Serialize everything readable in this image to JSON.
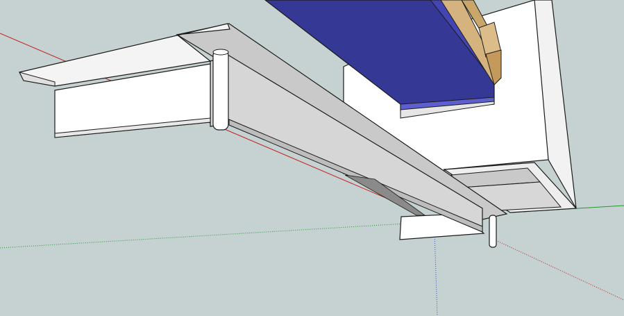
{
  "viewport": {
    "background": "#c6d1d1",
    "axes": {
      "red": "#c41e1e",
      "green": "#1f9a2a",
      "blue": "#3050c8"
    }
  },
  "model": {
    "components": [
      {
        "name": "cabinet-box",
        "color": "#ffffff"
      },
      {
        "name": "blue-panel",
        "color": "#363896"
      },
      {
        "name": "wood-rails",
        "color": "#d4b37e"
      },
      {
        "name": "table-top",
        "color": "#ffffff"
      },
      {
        "name": "long-rail",
        "color": "#d6d6d6"
      },
      {
        "name": "dowel-left",
        "color": "#ffffff"
      },
      {
        "name": "dowel-right",
        "color": "#ffffff"
      },
      {
        "name": "end-block",
        "color": "#ffffff"
      }
    ]
  }
}
